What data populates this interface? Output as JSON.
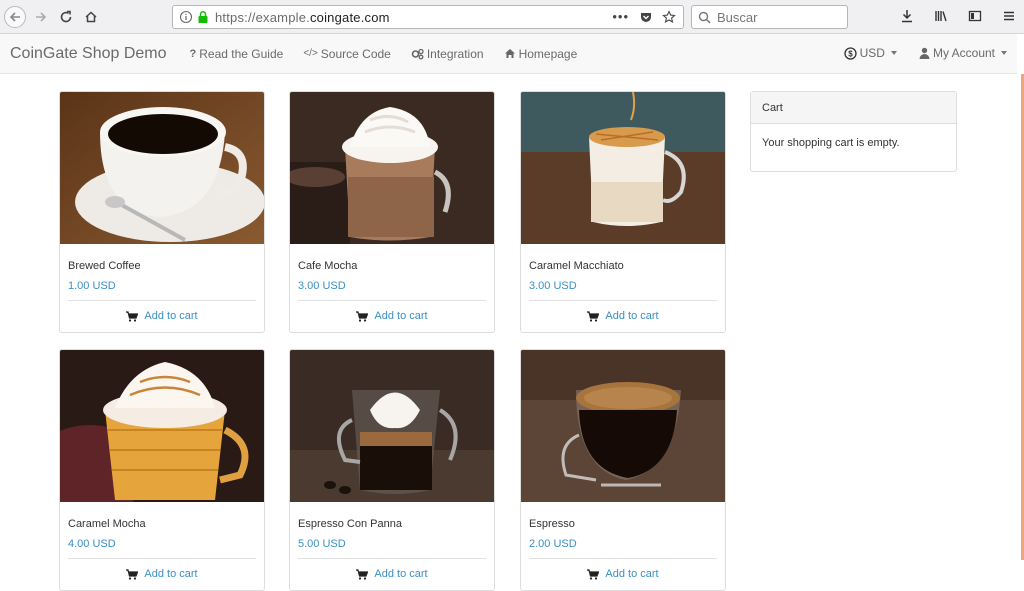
{
  "browser": {
    "url_prefix": "https://example.",
    "url_domain": "coingate.com",
    "search_placeholder": "Buscar"
  },
  "navbar": {
    "brand": "CoinGate Shop Demo",
    "links": [
      {
        "label": "Read the Guide",
        "icon": "question-icon"
      },
      {
        "label": "Source Code",
        "icon": "code-icon"
      },
      {
        "label": "Integration",
        "icon": "gears-icon"
      },
      {
        "label": "Homepage",
        "icon": "home-icon"
      }
    ],
    "currency": "USD",
    "account": "My Account"
  },
  "products": [
    {
      "name": "Brewed Coffee",
      "price": "1.00 USD",
      "add_label": "Add to cart"
    },
    {
      "name": "Cafe Mocha",
      "price": "3.00 USD",
      "add_label": "Add to cart"
    },
    {
      "name": "Caramel Macchiato",
      "price": "3.00 USD",
      "add_label": "Add to cart"
    },
    {
      "name": "Caramel Mocha",
      "price": "4.00 USD",
      "add_label": "Add to cart"
    },
    {
      "name": "Espresso Con Panna",
      "price": "5.00 USD",
      "add_label": "Add to cart"
    },
    {
      "name": "Espresso",
      "price": "2.00 USD",
      "add_label": "Add to cart"
    }
  ],
  "cart": {
    "title": "Cart",
    "empty_text": "Your shopping cart is empty."
  },
  "colors": {
    "link": "#3a8fc6",
    "navbar_bg": "#f8f8f8"
  }
}
